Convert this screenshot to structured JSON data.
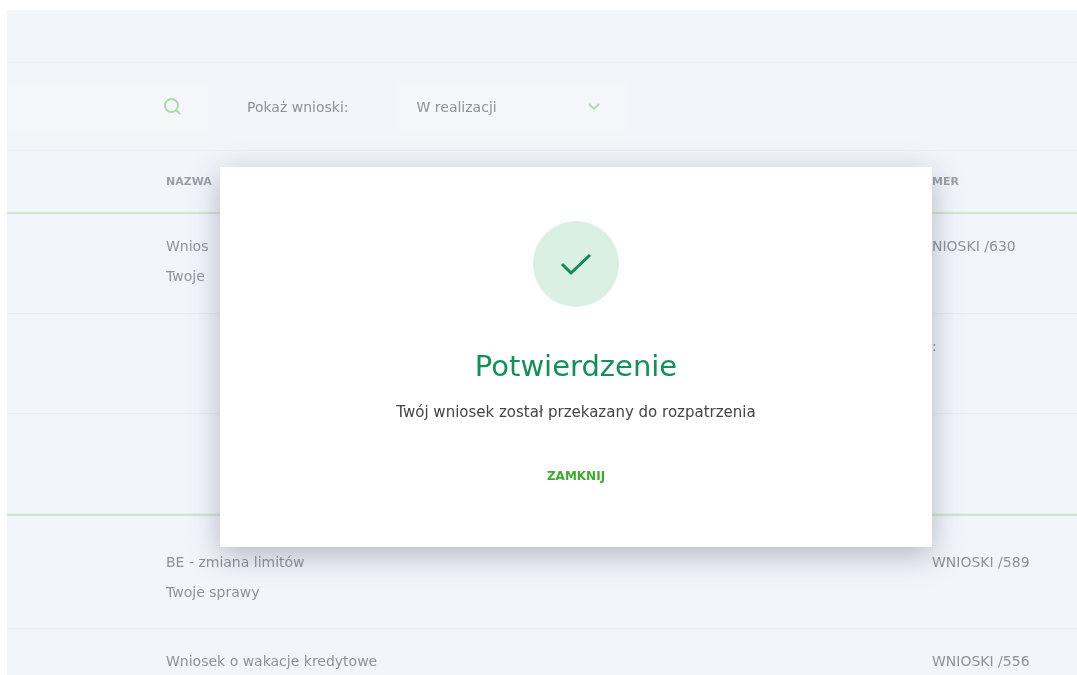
{
  "toolbar": {
    "filter_label": "Pokaż wnioski:",
    "filter": {
      "value": "W realizacji"
    }
  },
  "table": {
    "columns": [
      "NAZWA",
      "MER"
    ],
    "rows": [
      {
        "divider": false,
        "name": [
          "Wnios",
          "Twoje"
        ],
        "number": "NIOSKI /630"
      },
      {
        "divider": false,
        "name": [],
        "number": ":"
      },
      {
        "divider": false,
        "name": [],
        "number": ""
      },
      {
        "divider": true,
        "name": [
          "BE - zmiana limitów",
          "Twoje sprawy"
        ],
        "number": "WNIOSKI /589"
      },
      {
        "divider": false,
        "name": [
          "Wniosek o wakacje kredytowe"
        ],
        "number": "WNIOSKI /556"
      }
    ]
  },
  "dialog": {
    "title": "Potwierdzenie",
    "message": "Twój wniosek został przekazany do rozpatrzenia",
    "button": "ZAMKNIJ"
  }
}
